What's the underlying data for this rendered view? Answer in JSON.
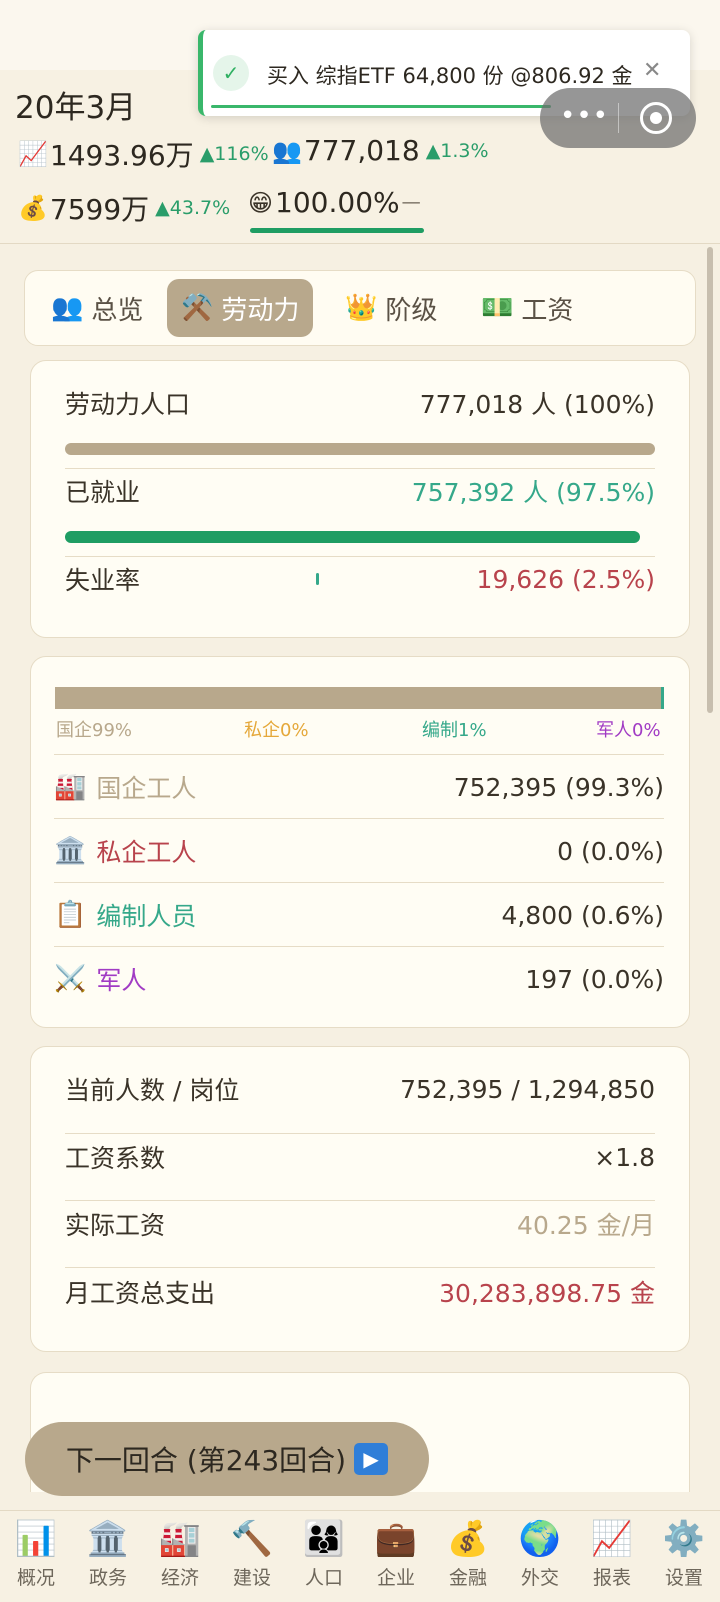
{
  "header": {
    "date": "20年3月",
    "gdp": {
      "icon": "📈",
      "value": "1493.96万",
      "change": "▲116%"
    },
    "population": {
      "icon": "👥",
      "value": "777,018",
      "change": "▲1.3%"
    },
    "treasury": {
      "icon": "💰",
      "value": "7599万",
      "change": "▲43.7%"
    },
    "happiness": {
      "icon": "😁",
      "value": "100.00%",
      "trend": "一"
    }
  },
  "toast": {
    "check": "✓",
    "text": "买入 综指ETF 64,800 份 @806.92 金",
    "close": "✕"
  },
  "capsule": {
    "dots": "•••"
  },
  "tabs": [
    {
      "icon": "👥",
      "label": "总览"
    },
    {
      "icon": "⚒️",
      "label": "劳动力"
    },
    {
      "icon": "👑",
      "label": "阶级"
    },
    {
      "icon": "💵",
      "label": "工资"
    }
  ],
  "labor": {
    "labor_pop_label": "劳动力人口",
    "labor_pop_value": "777,018 人 (100%)",
    "employed_label": "已就业",
    "employed_value": "757,392 人 (97.5%)",
    "employed_pct": 97.5,
    "unemp_label": "失业率",
    "unemp_value": "19,626 (2.5%)",
    "unemp_pct": 2.5,
    "colors": {
      "tan": "#b8a88c",
      "green": "#1f9d63",
      "red": "#b8434c",
      "orange": "#e5a83a",
      "teal": "#35a88a",
      "purple": "#a13bc4"
    }
  },
  "sectors": {
    "legend": [
      "国企99%",
      "私企0%",
      "编制1%",
      "军人0%"
    ],
    "shares": [
      99.3,
      0.0,
      0.6,
      0.0
    ],
    "rows": [
      {
        "icon": "🏭",
        "label": "国企工人",
        "value": "752,395 (99.3%)"
      },
      {
        "icon": "🏛️",
        "label": "私企工人",
        "value": "0 (0.0%)"
      },
      {
        "icon": "📋",
        "label": "编制人员",
        "value": "4,800 (0.6%)"
      },
      {
        "icon": "⚔️",
        "label": "军人",
        "value": "197 (0.0%)"
      }
    ]
  },
  "wages": {
    "rows": [
      {
        "label": "当前人数 / 岗位",
        "value": "752,395 / 1,294,850"
      },
      {
        "label": "工资系数",
        "value": "×1.8"
      },
      {
        "label": "实际工资",
        "value": "40.25 金/月"
      },
      {
        "label": "月工资总支出",
        "value": "30,283,898.75 金"
      }
    ]
  },
  "next_turn": {
    "label": "下一回合 (第243回合)",
    "icon": "▶"
  },
  "bottom_nav": [
    {
      "icon": "📊",
      "label": "概况"
    },
    {
      "icon": "🏛️",
      "label": "政务"
    },
    {
      "icon": "🏭",
      "label": "经济"
    },
    {
      "icon": "🔨",
      "label": "建设"
    },
    {
      "icon": "👨‍👩‍👦",
      "label": "人口"
    },
    {
      "icon": "💼",
      "label": "企业"
    },
    {
      "icon": "💰",
      "label": "金融"
    },
    {
      "icon": "🌍",
      "label": "外交"
    },
    {
      "icon": "📈",
      "label": "报表"
    },
    {
      "icon": "⚙️",
      "label": "设置"
    }
  ]
}
